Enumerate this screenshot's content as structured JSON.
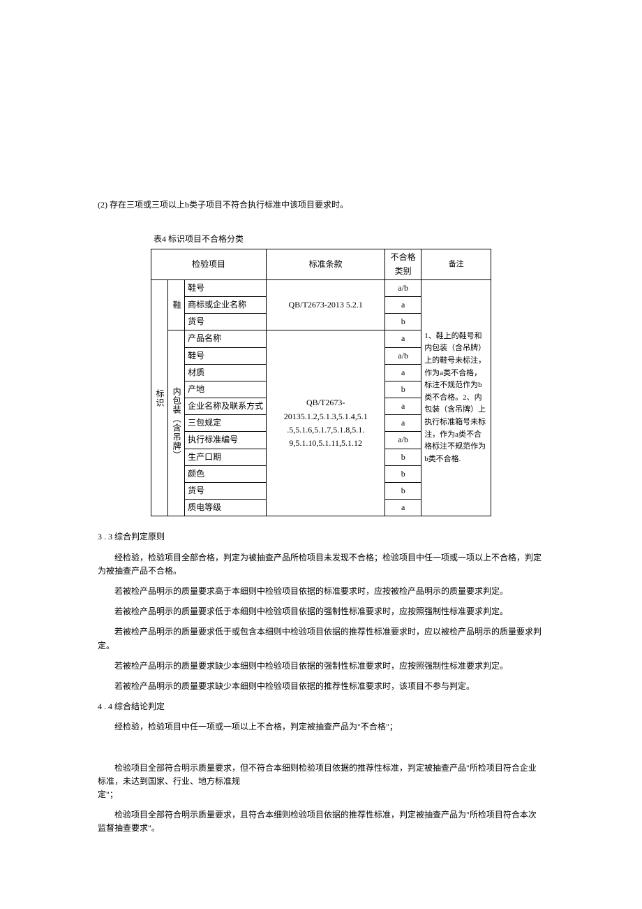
{
  "pre_text": "(2) 存在三项或三项以上b类子项目不符合执行标准中该项目要求时。",
  "table_caption": "表4 标识项目不合格分类",
  "headers": {
    "c1": "检验项目",
    "c2": "标准条款",
    "c3": "不合格类别",
    "c4": "备注"
  },
  "vcol1": "标识",
  "vcol2a": "鞋",
  "vcol2b": "内包装（含吊牌）",
  "std1": "QB/T2673-2013 5.2.1",
  "std2_l1": "QB/T2673-",
  "std2_l2": "20135.1.2,5.1.3,5.1.4,5.1",
  "std2_l3": ".5,5.1.6,5.1.7,5.1.8,5.1.",
  "std2_l4": "9,5.1.10,5.1.11,5.1.12",
  "rows": [
    {
      "item": "鞋号",
      "cat": "a/b"
    },
    {
      "item": "商标或企业名称",
      "cat": "a"
    },
    {
      "item": "货号",
      "cat": "b"
    },
    {
      "item": "产品名称",
      "cat": "a"
    },
    {
      "item": "鞋号",
      "cat": "a/b"
    },
    {
      "item": "材质",
      "cat": "a"
    },
    {
      "item": "产地",
      "cat": "b"
    },
    {
      "item": "企业名称及联系方式",
      "cat": "a"
    },
    {
      "item": "三包规定",
      "cat": "a"
    },
    {
      "item": "执行标准编号",
      "cat": "a/b"
    },
    {
      "item": "生产口期",
      "cat": "b"
    },
    {
      "item": "颜色",
      "cat": "b"
    },
    {
      "item": "货号",
      "cat": "b"
    },
    {
      "item": "质电等级",
      "cat": "a"
    }
  ],
  "remark": "1、鞋上的鞋号和内包装（含吊牌）上的鞋号未标注，作为a类不合格，标注不规范作为b类不合格。2、内包装（含吊牌）上执行标准箱号未标注，作为a类不合格标注不规范作为b类不合格.",
  "s3_num": "3",
  "s3_sub": ". 3 综合判定原则",
  "s3_p1": "经检验，检验项目全部合格，判定为被抽查产品所检项目未发现不合格；检验项目中任一项或一项以上不合格，判定为被抽查产品不合格。",
  "s3_p2": "若被检产品明示的质量要求高于本细则中检验项目依据的标准要求时，应按被检产品明示的质量要求判定。",
  "s3_p3": "若被检产品明示的质量要求低于本细则中检验项目依据的强制性标准要求时，应按照强制性标准要求判定。",
  "s3_p4": "若被检产品明示的质量要求低于或包含本细则中检验项目依据的推荐性标准要求时，应以被检产品明示的质量要求判定。",
  "s3_p5": "若被检产品明示的质量要求缺少本细则中检验项目依据的强制性标准要求时，应按照强制性标准要求判定。",
  "s3_p6": "若被检产品明示的质量要求缺少本细则中检验项目依据的推荐性标准要求时，该项目不参与判定。",
  "s4_num": "4",
  "s4_sub": ". 4 综合结论判定",
  "s4_p1": "经检验，检验项目中任一项或一项以上不合格，判定被抽查产品为\"不合格\"；",
  "s4_p2_a": "检验项目全部符合明示质量要求，但不符合本细则检验项目依据的推荐性标准，判定被抽查产品\"所检项目符合企业标准，未达到国家、行业、地方标准规",
  "s4_p2_b": "定\"；",
  "s4_p3": "检验项目全部符合明示质量要求，且符合本细则检验项目依据的推荐性标准，判定被抽查产品为\"所检项目符合本次监督抽查要求\"。"
}
